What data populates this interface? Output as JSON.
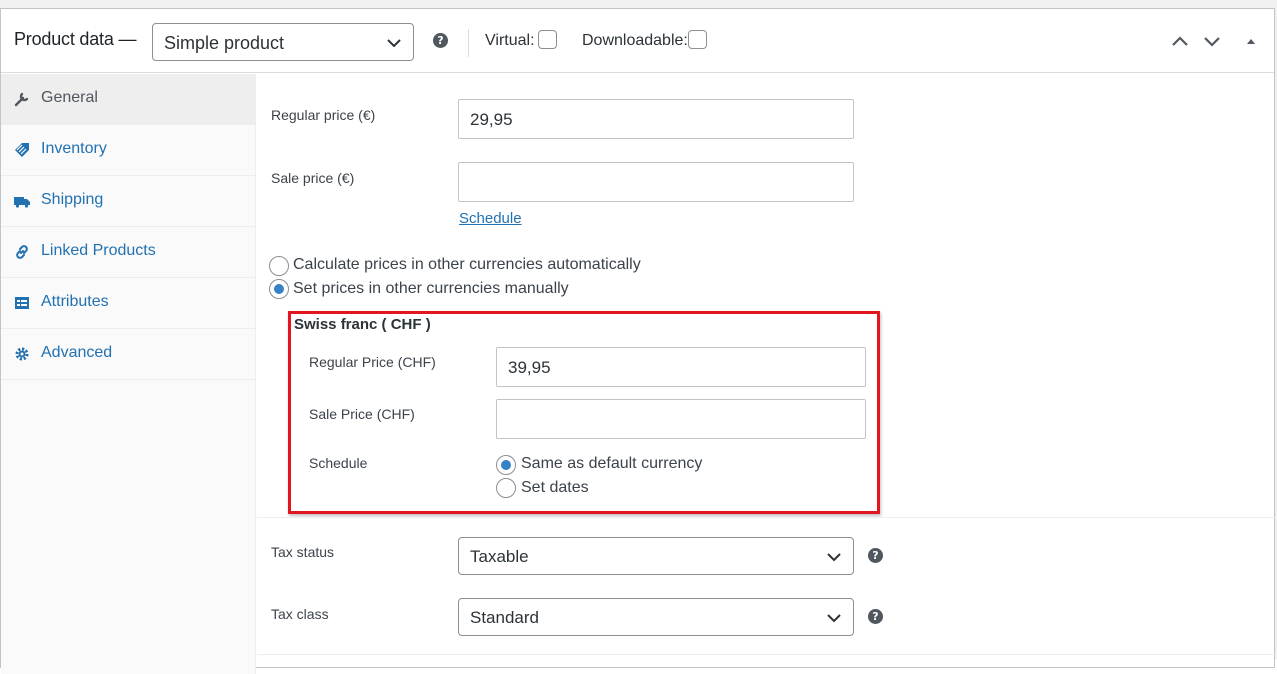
{
  "header": {
    "title": "Product data —",
    "product_type": "Simple product",
    "virtual_label": "Virtual:",
    "downloadable_label": "Downloadable:"
  },
  "tabs": [
    {
      "label": "General",
      "icon": "wrench-icon",
      "active": true
    },
    {
      "label": "Inventory",
      "icon": "tag-icon"
    },
    {
      "label": "Shipping",
      "icon": "truck-icon"
    },
    {
      "label": "Linked Products",
      "icon": "link-icon"
    },
    {
      "label": "Attributes",
      "icon": "list-card-icon"
    },
    {
      "label": "Advanced",
      "icon": "gear-icon"
    }
  ],
  "general": {
    "regular_price_label": "Regular price (€)",
    "regular_price_value": "29,95",
    "sale_price_label": "Sale price (€)",
    "sale_price_value": "",
    "schedule_link": "Schedule",
    "currency_mode_options": [
      {
        "label": "Calculate prices in other currencies automatically",
        "selected": false
      },
      {
        "label": "Set prices in other currencies manually",
        "selected": true
      }
    ]
  },
  "currency_block": {
    "title": "Swiss franc ( CHF )",
    "regular_price_label": "Regular Price (CHF)",
    "regular_price_value": "39,95",
    "sale_price_label": "Sale Price (CHF)",
    "sale_price_value": "",
    "schedule_label": "Schedule",
    "schedule_options": [
      {
        "label": "Same as default currency",
        "selected": true
      },
      {
        "label": "Set dates",
        "selected": false
      }
    ]
  },
  "tax": {
    "status_label": "Tax status",
    "status_value": "Taxable",
    "class_label": "Tax class",
    "class_value": "Standard"
  },
  "colors": {
    "link": "#2271b1",
    "highlight_border": "#e2161f",
    "radio_checked": "#3582c4"
  }
}
